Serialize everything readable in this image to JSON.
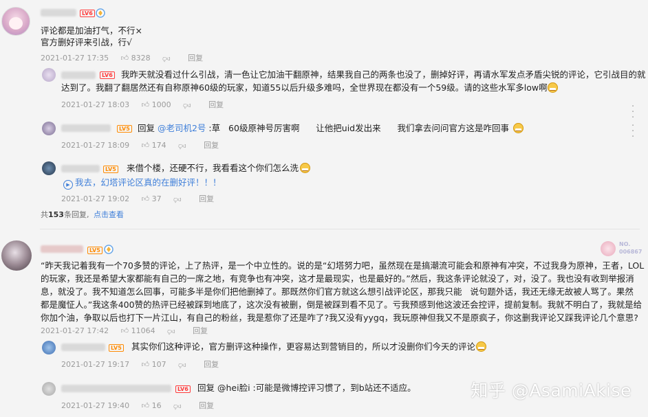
{
  "comments": [
    {
      "id": "c1",
      "level": "LV6",
      "lines": [
        "评论都是加油打气，不行×",
        "官方删好评来引战，行√"
      ],
      "time": "2021-01-27 17:35",
      "likes": "8328",
      "reply_label": "回复",
      "replies": [
        {
          "level": "LV6",
          "text_line1": "我昨天就没看过什么引战，清一色让它加油干翻原神，结果我自己的两条也没了，删掉好评，再请水军发点矛盾尖锐的评论，它引战目的就",
          "text_line2": "达到了。我翻了翻居然还有自称原神60级的玩家，知道55以后升级多难吗，全世界现在都没有一个59级。请的这些水军多low啊",
          "time": "2021-01-27 18:03",
          "likes": "1000",
          "reply_label": "回复"
        },
        {
          "level": "LV5",
          "prefix": "回复 ",
          "mention": "@老司机2号",
          "text": " :草   60级原神号厉害啊      让他把uid发出来      我们拿去问问官方这是咋回事",
          "time": "2021-01-27 18:09",
          "likes": "174",
          "reply_label": "回复"
        },
        {
          "level": "LV5",
          "text": "来借个楼，还硬不行，我看看这个你们怎么洗",
          "link_text": "我去，幻塔评论区真的在删好评！！！",
          "time": "2021-01-27 19:02",
          "likes": "37",
          "reply_label": "回复"
        }
      ],
      "footer_prefix": "共",
      "footer_count": "153",
      "footer_suffix": "条回复,",
      "footer_link": "点击查看"
    },
    {
      "id": "c2",
      "level": "LV5",
      "badge_no": "NO.",
      "badge_num": "006867",
      "lines": [
        "“昨天我记着我有一个70多赞的评论，上了热评，是一个中立性的。说的是“幻塔努力吧，虽然现在是搞潮流可能会和原神有冲突，不过我身为原神，王者，LOL",
        "的玩家，我还是希望大家都能有自己的一席之地，有竞争也有冲突，这才是最现实，也是最好的。”然后，我这条评论就没了，对，没了。我也没有收到举报消",
        "息，就没了。我不知道怎么回事，可能多半是你们把他删掉了。那既然你们官方就这么想引战评论区，那我只能   说句题外话，我还无缘无故被人骂了。果然",
        "都是魔怔人。”我这条400赞的热评已经被踩到地底了，这次没有被删，倒是被踩到看不见了。亏我预感到他这波还会控评，提前复制。我就不明白了，我就是给",
        "你加个油，争取以后也打下一片江山，有自己的粉丝，我是惹你了还是咋了?我又没有yygq，我玩原神但我又不是原疯子，你这删我评论又踩我评论几个意思?"
      ],
      "time": "2021-01-27 17:42",
      "likes": "11064",
      "reply_label": "回复",
      "replies": [
        {
          "level": "LV5",
          "text": "其实你们这种评论，官方删评这种操作，更容易达到营销目的，所以才没删你们今天的评论",
          "time": "2021-01-27 19:17",
          "likes": "107",
          "reply_label": "回复"
        },
        {
          "level": "LV6",
          "prefix": "回复 ",
          "mention": "@hei脸i",
          "text": " :可能是微博控评习惯了，到b站还不适应。",
          "time": "2021-01-27 19:40",
          "likes": "16",
          "reply_label": "回复"
        }
      ]
    }
  ],
  "watermark": "知乎 @AsamiAkise"
}
